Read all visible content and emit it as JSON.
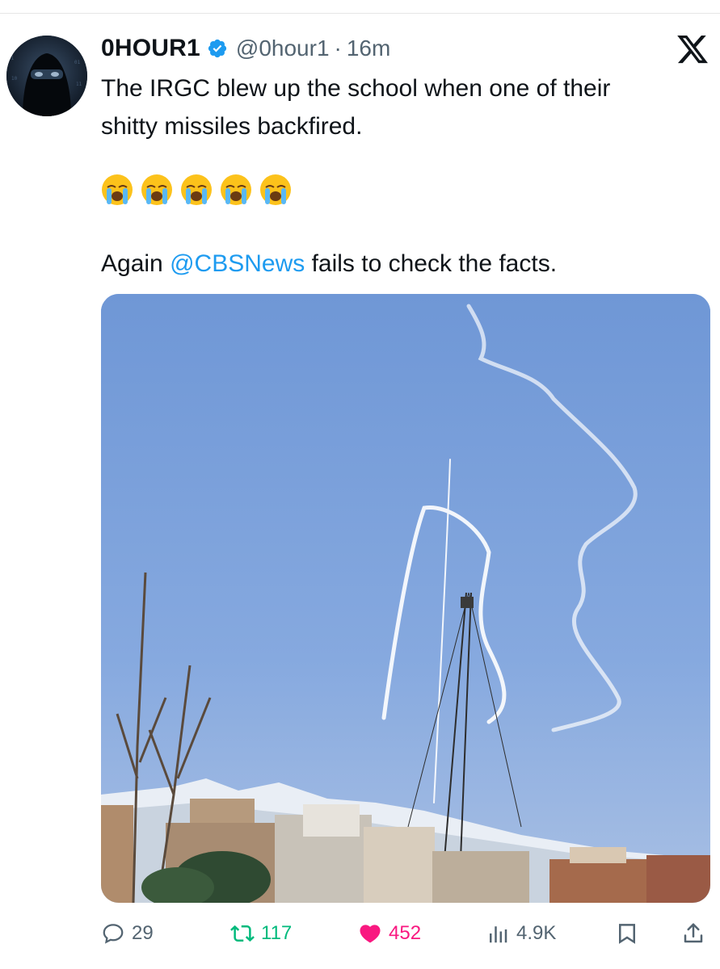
{
  "author": {
    "name": "0HOUR1",
    "handle": "@0hour1",
    "separator": "·",
    "time": "16m",
    "verified": true
  },
  "tweet": {
    "line1": "The IRGC blew up the school when one of their",
    "line2": "shitty missiles backfired.",
    "emojis": [
      "😭",
      "😭",
      "😭",
      "😭",
      "😭"
    ],
    "line3_before": "Again ",
    "mention": "@CBSNews",
    "line3_after": " fails to check the facts."
  },
  "actions": {
    "replies": "29",
    "retweets": "117",
    "likes": "452",
    "views": "4.9K"
  },
  "icons": {
    "verified": "verified-badge-icon",
    "close": "x-logo-icon",
    "reply": "reply-icon",
    "retweet": "retweet-icon",
    "like": "heart-icon",
    "views": "views-icon",
    "bookmark": "bookmark-icon",
    "share": "share-icon"
  },
  "colors": {
    "accent": "#1d9bf0",
    "retweet": "#00ba7c",
    "like": "#f91880",
    "muted": "#536471"
  }
}
